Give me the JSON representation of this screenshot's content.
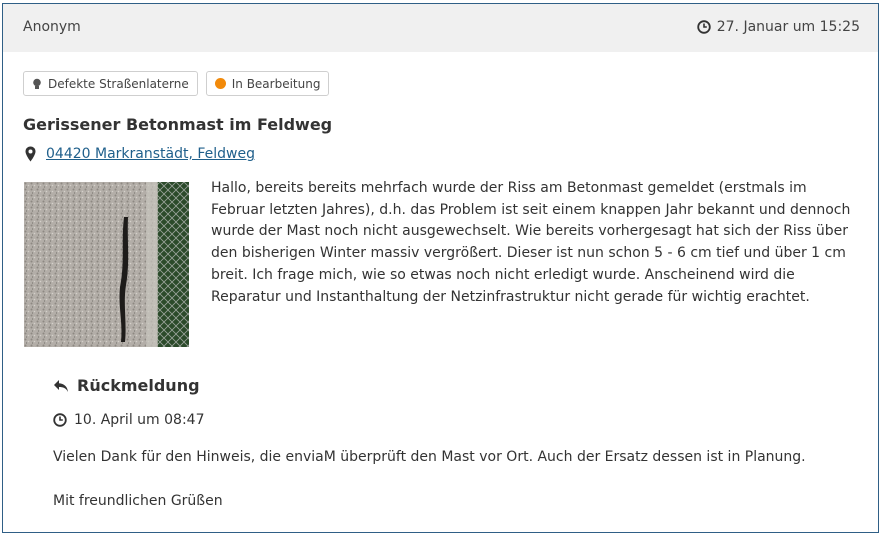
{
  "header": {
    "author": "Anonym",
    "date": "27. Januar um 15:25"
  },
  "tags": {
    "category": "Defekte Straßenlaterne",
    "status": "In Bearbeitung"
  },
  "report": {
    "title": "Gerissener Betonmast im Feldweg",
    "location": "04420 Markranstädt, Feldweg",
    "text": "Hallo, bereits bereits mehrfach wurde der Riss am Betonmast gemeldet (erstmals im Februar letzten Jahres), d.h. das Problem ist seit einem knappen Jahr bekannt und dennoch wurde der Mast noch nicht ausgewechselt. Wie bereits vorhergesagt hat sich der Riss über den bisherigen Winter massiv vergrößert. Dieser ist nun schon 5 - 6 cm tief und über 1 cm breit. Ich frage mich, wie so etwas noch nicht erledigt wurde. Anscheinend wird die Reparatur und Instanthaltung der Netzinfrastruktur nicht gerade für wichtig erachtet."
  },
  "feedback": {
    "heading": "Rückmeldung",
    "date": "10. April um 08:47",
    "text": "Vielen Dank für den Hinweis, die enviaM überprüft den Mast vor Ort. Auch der Ersatz dessen ist in Planung.",
    "signoff": "Mit freundlichen Grüßen"
  },
  "colors": {
    "link": "#1f5f8b",
    "status_dot": "#f28a0a",
    "border": "#2f5f86"
  },
  "icons": [
    "clock-icon",
    "bulb-icon",
    "status-dot-icon",
    "map-marker-icon",
    "reply-icon"
  ]
}
